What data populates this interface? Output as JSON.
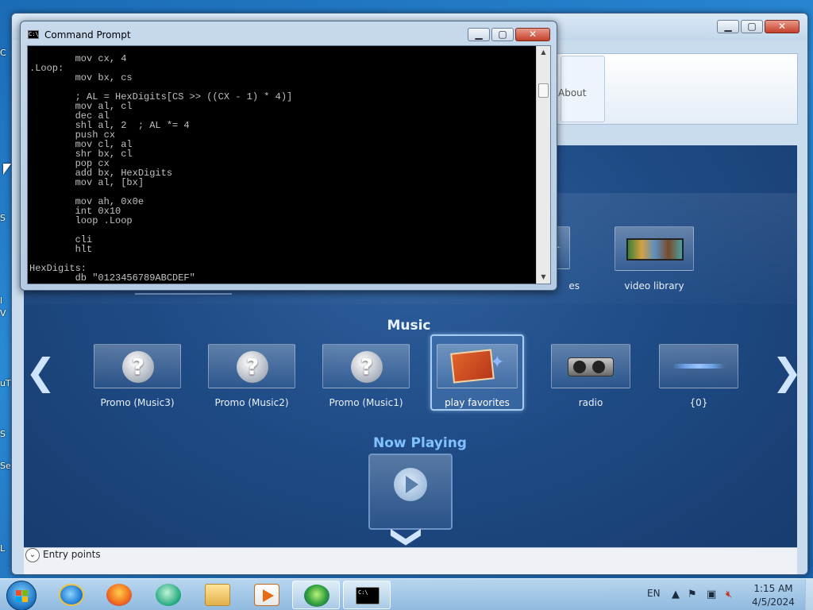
{
  "desktop": {
    "fragments": [
      "C",
      "S",
      "l",
      "V",
      "uT",
      "S",
      "L",
      "Se"
    ]
  },
  "media_center": {
    "ribbon_about": "About",
    "partial_labels": {
      "pictures_tail": "es",
      "video_library": "video library"
    },
    "music": {
      "title": "Music",
      "items": [
        {
          "label": "Promo (Music3)",
          "icon": "question-icon"
        },
        {
          "label": "Promo (Music2)",
          "icon": "question-icon"
        },
        {
          "label": "Promo (Music1)",
          "icon": "question-icon"
        },
        {
          "label": "play favorites",
          "icon": "album-stack-icon",
          "selected": true
        },
        {
          "label": "radio",
          "icon": "radio-icon"
        },
        {
          "label": "{0}",
          "icon": "waveform-icon"
        }
      ]
    },
    "now_playing": {
      "title": "Now Playing"
    },
    "status": {
      "label": "Entry points"
    }
  },
  "cmd": {
    "title": "Command Prompt",
    "icon_text": "C:\\",
    "lines": [
      "        mov cx, 4",
      ".Loop:",
      "        mov bx, cs",
      "",
      "        ; AL = HexDigits[CS >> ((CX - 1) * 4)]",
      "        mov al, cl",
      "        dec al",
      "        shl al, 2  ; AL *= 4",
      "        push cx",
      "        mov cl, al",
      "        shr bx, cl",
      "        pop cx",
      "        add bx, HexDigits",
      "        mov al, [bx]",
      "",
      "        mov ah, 0x0e",
      "        int 0x10",
      "        loop .Loop",
      "",
      "        cli",
      "        hlt",
      "",
      "HexDigits:",
      "        db \"0123456789ABCDEF\""
    ]
  },
  "taskbar": {
    "language": "EN",
    "time": "1:15 AM",
    "date": "4/5/2024"
  }
}
